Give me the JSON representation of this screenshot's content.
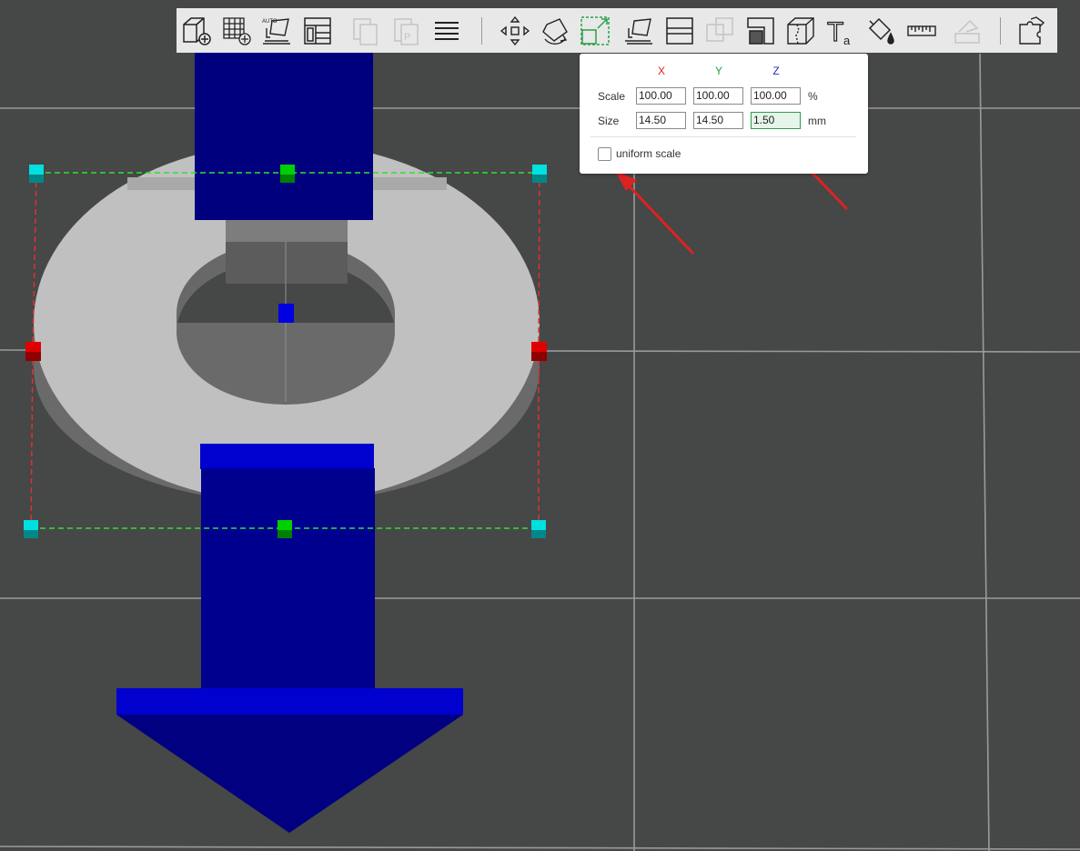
{
  "toolbar": {
    "buttons": [
      {
        "name": "add-object-button",
        "icon": "cube-plus-icon"
      },
      {
        "name": "add-plate-button",
        "icon": "grid-plus-icon"
      },
      {
        "name": "auto-orient-button",
        "icon": "auto-orient-icon",
        "text": "AUTO"
      },
      {
        "name": "arrange-button",
        "icon": "arrange-icon"
      },
      {
        "name": "copy-button",
        "icon": "copy-icon"
      },
      {
        "name": "paste-button",
        "icon": "paste-icon"
      },
      {
        "name": "layers-button",
        "icon": "layers-icon"
      },
      {
        "name": "move-button",
        "icon": "move-icon"
      },
      {
        "name": "rotate-button",
        "icon": "rotate-icon"
      },
      {
        "name": "scale-button",
        "icon": "scale-icon"
      },
      {
        "name": "lay-on-face-button",
        "icon": "lay-on-face-icon"
      },
      {
        "name": "cut-button",
        "icon": "cut-icon"
      },
      {
        "name": "boolean-button",
        "icon": "boolean-icon"
      },
      {
        "name": "support-painting-button",
        "icon": "support-paint-icon"
      },
      {
        "name": "seam-painting-button",
        "icon": "seam-paint-icon"
      },
      {
        "name": "text-button",
        "icon": "text-icon",
        "text": "T",
        "sub": "a"
      },
      {
        "name": "color-painting-button",
        "icon": "paint-bucket-icon"
      },
      {
        "name": "measure-button",
        "icon": "ruler-icon"
      },
      {
        "name": "assembly-button",
        "icon": "assembly-icon"
      },
      {
        "name": "split-parts-button",
        "icon": "puzzle-icon"
      }
    ]
  },
  "scale_panel": {
    "axes": [
      "X",
      "Y",
      "Z"
    ],
    "axis_colors": [
      "#e02020",
      "#20a040",
      "#2030c0"
    ],
    "scale_label": "Scale",
    "size_label": "Size",
    "scale_values": [
      "100.00",
      "100.00",
      "100.00"
    ],
    "size_values": [
      "14.50",
      "14.50",
      "1.50"
    ],
    "scale_unit": "%",
    "size_unit": "mm",
    "uniform_scale_label": "uniform scale",
    "uniform_scale_checked": false
  },
  "scene": {
    "background_color": "#464747",
    "ring_color": "#c0c0c0",
    "arrow_color": "#000c96"
  }
}
